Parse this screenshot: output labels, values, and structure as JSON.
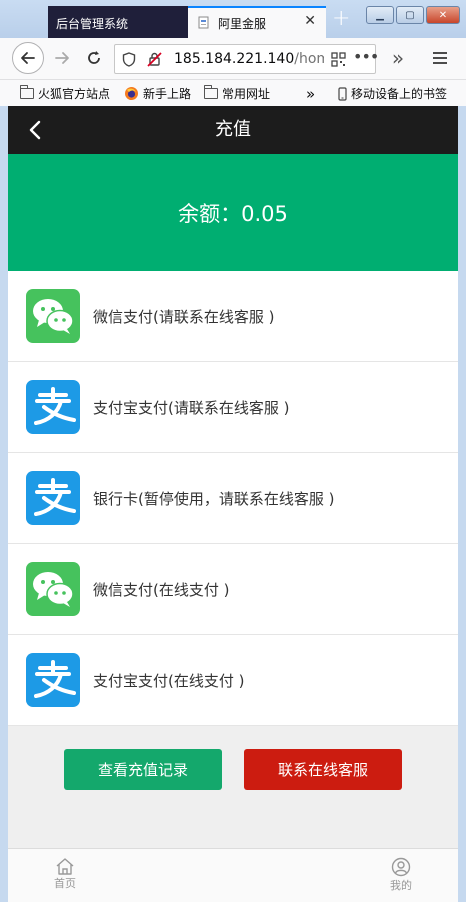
{
  "browser": {
    "tabs": [
      {
        "title": "后台管理系统",
        "active": false
      },
      {
        "title": "阿里金服",
        "active": true
      }
    ],
    "new_tab_symbol": "+",
    "url_host": "185.184.221.140",
    "url_path": "/home",
    "overflow_symbol": "»",
    "bookmarks": [
      {
        "label": "火狐官方站点",
        "icon": "folder-icon"
      },
      {
        "label": "新手上路",
        "icon": "firefox-icon"
      },
      {
        "label": "常用网址",
        "icon": "folder-icon"
      },
      {
        "label": "移动设备上的书签",
        "icon": "mobile-icon"
      }
    ],
    "accent_color": "#0a84ff"
  },
  "app": {
    "header_title": "充值",
    "balance_text": "余额：0.05",
    "payment_methods": [
      {
        "label": "微信支付(请联系在线客服 )",
        "icon": "wechat-icon"
      },
      {
        "label": "支付宝支付(请联系在线客服 )",
        "icon": "alipay-icon"
      },
      {
        "label": "银行卡(暂停使用，请联系在线客服 )",
        "icon": "alipay-icon"
      },
      {
        "label": "微信支付(在线支付 )",
        "icon": "wechat-icon"
      },
      {
        "label": "支付宝支付(在线支付 )",
        "icon": "alipay-icon"
      }
    ],
    "buttons": {
      "records": "查看充值记录",
      "contact": "联系在线客服"
    },
    "tabbar": {
      "home": "首页",
      "mine": "我的"
    },
    "colors": {
      "header_bg": "#1c1c1c",
      "balance_bg": "#00ae71",
      "wechat": "#46c25d",
      "alipay": "#1d9ae6",
      "btn_green": "#14a86c",
      "btn_red": "#cc1c10"
    }
  }
}
